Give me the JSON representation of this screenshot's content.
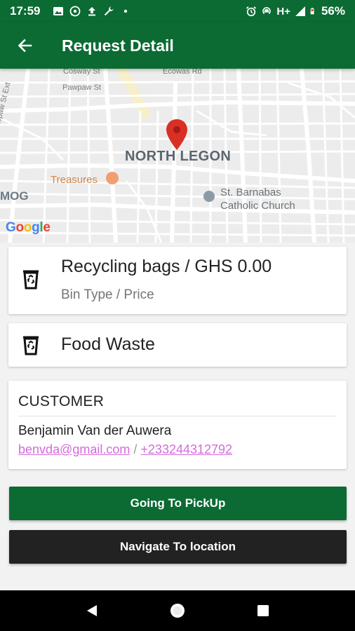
{
  "status_bar": {
    "time": "17:59",
    "network": "H+",
    "battery": "56%",
    "left_icons": [
      "image-icon",
      "whatsapp-icon",
      "upload-icon",
      "wrench-icon",
      "dot-icon"
    ],
    "right_icons": [
      "alarm-icon",
      "hotspot-icon",
      "signal-icon",
      "battery-icon"
    ]
  },
  "app_bar": {
    "title": "Request Detail",
    "back_icon": "arrow-left-icon"
  },
  "map": {
    "labels": {
      "cosway": "Cosway St",
      "ecowas": "Ecowas Rd",
      "pawpaw": "Pawpaw St",
      "pawpaw_ext": "Pawpaw St Ext",
      "area": "NORTH LEGON",
      "treasures": "Treasures",
      "st_barnabas": "St. Barnabas",
      "church": "Catholic Church",
      "mog": "MOG"
    },
    "google": [
      "G",
      "o",
      "o",
      "g",
      "l",
      "e"
    ],
    "marker_icon": "map-pin-icon"
  },
  "bin": {
    "title": "Recycling bags / GHS 0.00",
    "subtitle": "Bin Type / Price",
    "icon": "recycle-bin-icon"
  },
  "waste": {
    "title": "Food Waste",
    "icon": "recycle-bin-icon"
  },
  "customer": {
    "heading": "CUSTOMER",
    "name": "Benjamin Van der Auwera",
    "email": "benvda@gmail.com",
    "separator": "/",
    "phone": "+233244312792"
  },
  "buttons": {
    "pickup": "Going To PickUp",
    "navigate": "Navigate To location"
  },
  "colors": {
    "primary": "#0b6b32",
    "dark_button": "#222222",
    "link": "#d56adc",
    "marker": "#d93025"
  }
}
